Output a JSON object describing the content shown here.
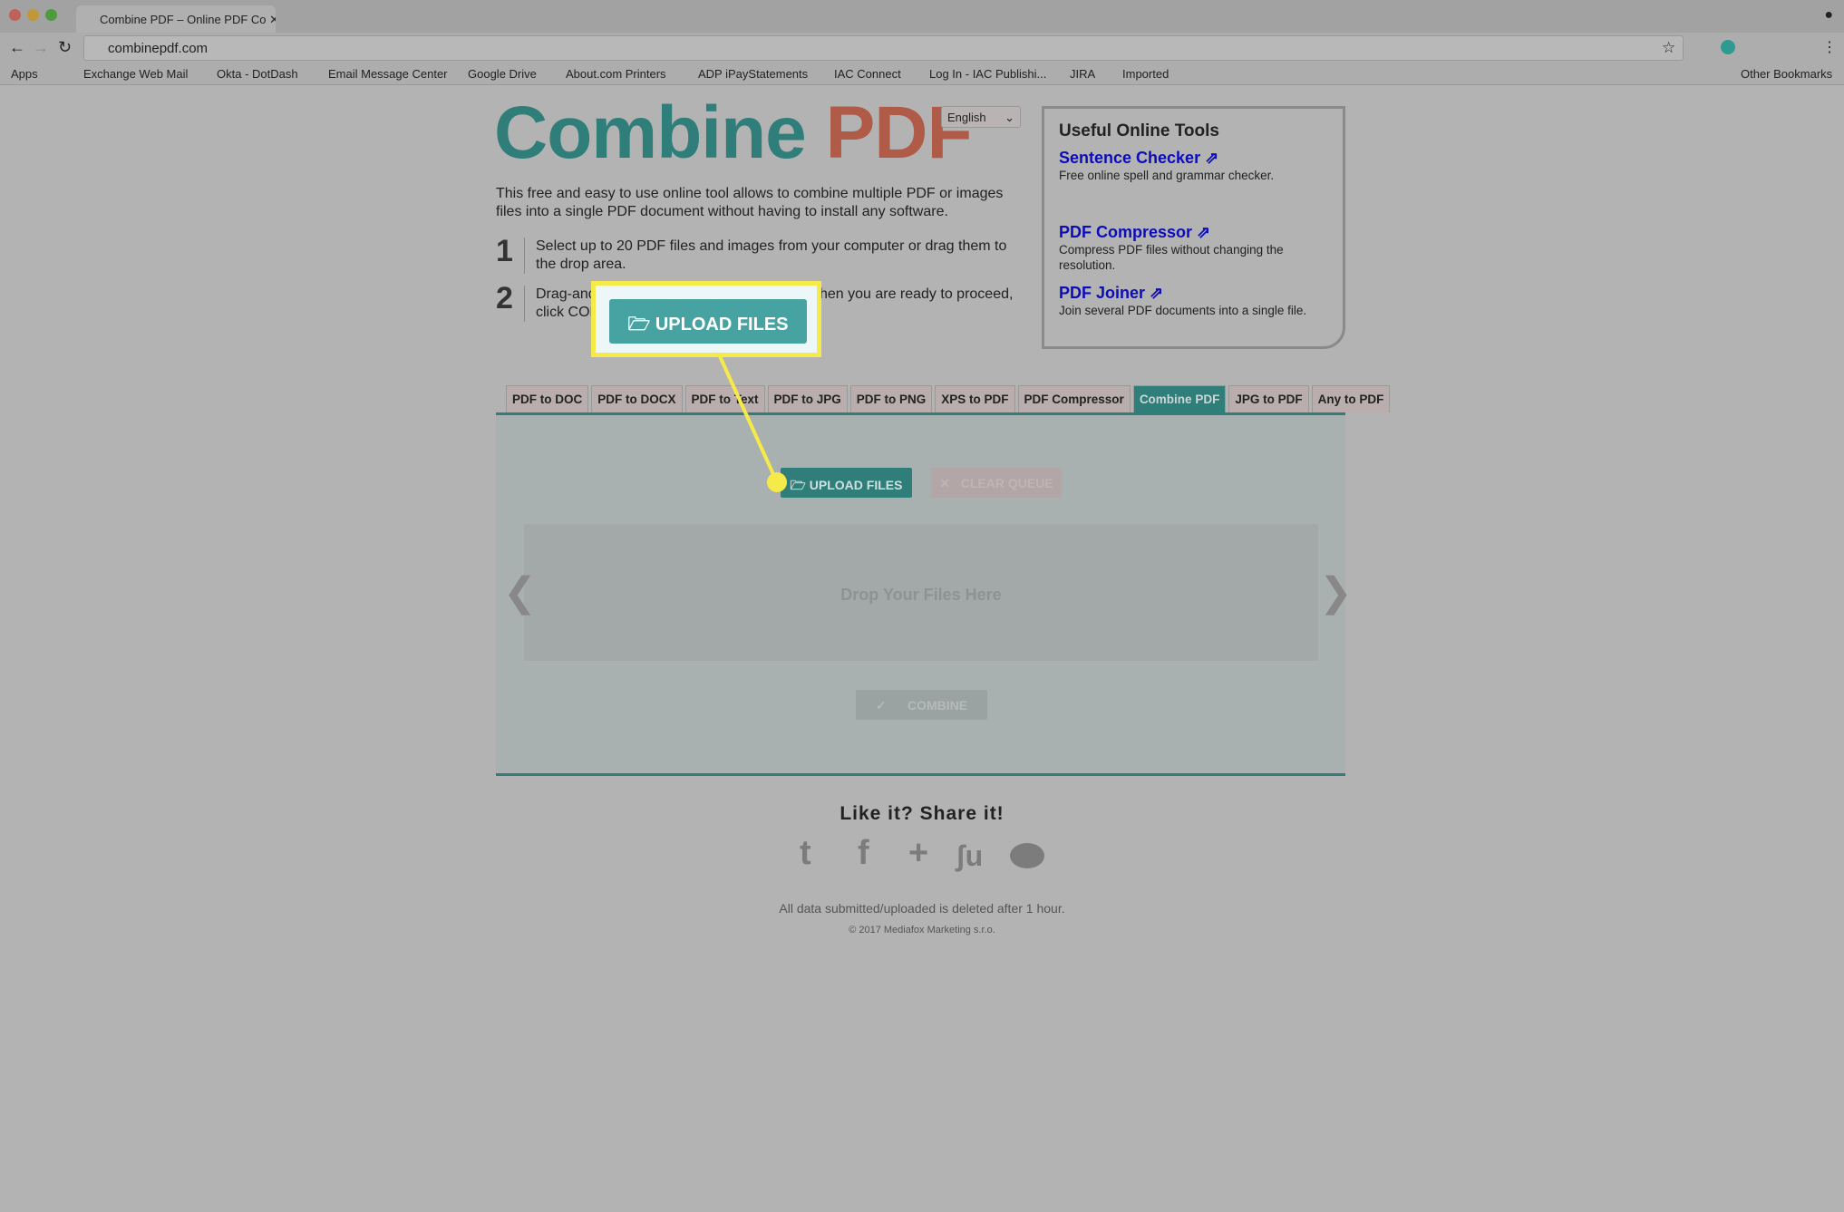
{
  "browser": {
    "tab_title": "Combine PDF – Online PDF Co",
    "url": "combinepdf.com",
    "bookmarks": [
      "Apps",
      "Exchange Web Mail",
      "Okta - DotDash",
      "Email Message Center",
      "Google Drive",
      "About.com Printers",
      "ADP iPayStatements",
      "IAC Connect",
      "Log In - IAC Publishi...",
      "JIRA",
      "Imported"
    ],
    "other_bookmarks": "Other Bookmarks"
  },
  "logo": {
    "part1": "Combine",
    "part2": "PDF",
    "color1": "#2f7e79",
    "color2": "#b05a48"
  },
  "language": "English",
  "description": "This free and easy to use online tool allows to combine multiple PDF or images files into a single PDF document without having to install any software.",
  "steps": [
    {
      "num": "1",
      "text": "Select up to 20 PDF files and images from your computer or drag them to the drop area."
    },
    {
      "num": "2",
      "text": "Drag-and-c                                                 When you are ready to proceed, click COMB"
    }
  ],
  "tools": {
    "title": "Useful Online Tools",
    "items": [
      {
        "name": "Sentence Checker ⇗",
        "desc": "Free online spell and grammar checker."
      },
      {
        "name": "PDF Compressor ⇗",
        "desc": "Compress PDF files without changing the resolution."
      },
      {
        "name": "PDF Joiner ⇗",
        "desc": "Join several PDF documents into a single file."
      }
    ]
  },
  "tabs": [
    "PDF to DOC",
    "PDF to DOCX",
    "PDF to Text",
    "PDF to JPG",
    "PDF to PNG",
    "XPS to PDF",
    "PDF Compressor",
    "Combine PDF",
    "JPG to PDF",
    "Any to PDF"
  ],
  "active_tab": "Combine PDF",
  "panel": {
    "upload": "UPLOAD FILES",
    "clear": "✕   CLEAR QUEUE",
    "drop": "Drop Your Files Here",
    "combine": "✓      COMBINE",
    "prev": "❮",
    "next": "❯"
  },
  "highlight": {
    "label": "UPLOAD FILES",
    "color": "#f6e94a"
  },
  "footer": {
    "share": "Like it? Share it!",
    "notice": "All data submitted/uploaded is deleted after 1 hour.",
    "copyright": "© 2017 Mediafox Marketing s.r.o."
  }
}
